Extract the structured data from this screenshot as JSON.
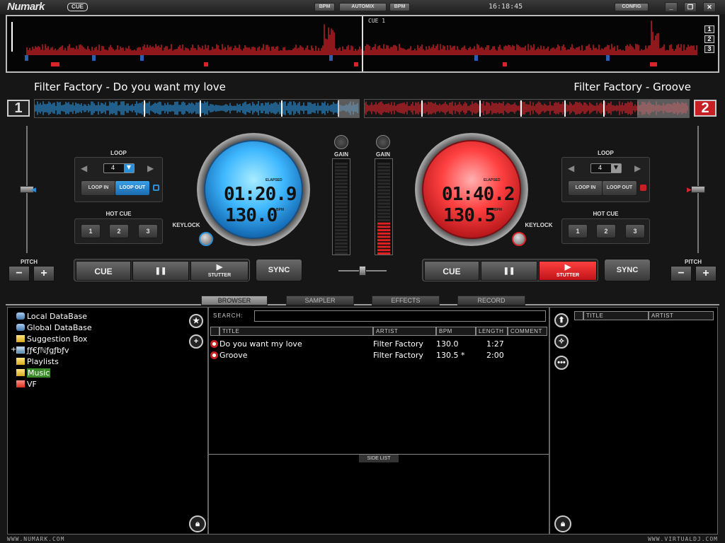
{
  "titlebar": {
    "logo": "Numark",
    "logo_tag": "CUE",
    "bpm_left": "BPM",
    "automix": "AUTOMIX",
    "bpm_right": "BPM",
    "clock": "16:18:45",
    "config": "CONFIG",
    "minimize": "_",
    "restore": "❐",
    "close": "✕"
  },
  "overview": {
    "cue_label": "CUE 1",
    "deck_selectors": [
      "1",
      "2",
      "3"
    ]
  },
  "deck1": {
    "number": "1",
    "title": "Filter Factory - Do you want my love",
    "loop_label": "LOOP",
    "loop_value": "4",
    "loop_in": "LOOP IN",
    "loop_out": "LOOP OUT",
    "hot_cue_label": "HOT CUE",
    "hot_cues": [
      "1",
      "2",
      "3"
    ],
    "pitch_label": "PITCH",
    "pitch_minus": "−",
    "pitch_plus": "+",
    "keylock": "KEYLOCK",
    "elapsed_label": "ELAPSED",
    "bpm_label": "BPM",
    "time": "01:20.9",
    "bpm": "130.0",
    "cue": "CUE",
    "pause": "❚❚",
    "play_icon": "▶",
    "stutter": "STUTTER",
    "sync": "SYNC",
    "gain": "GAIN",
    "accent": "#2a8fd6"
  },
  "deck2": {
    "number": "2",
    "title": "Filter Factory - Groove",
    "loop_label": "LOOP",
    "loop_value": "4",
    "loop_in": "LOOP IN",
    "loop_out": "LOOP OUT",
    "hot_cue_label": "HOT CUE",
    "hot_cues": [
      "1",
      "2",
      "3"
    ],
    "pitch_label": "PITCH",
    "pitch_minus": "−",
    "pitch_plus": "+",
    "keylock": "KEYLOCK",
    "elapsed_label": "ELAPSED",
    "bpm_label": "BPM",
    "time": "01:40.2",
    "bpm": "130.5",
    "cue": "CUE",
    "pause": "❚❚",
    "play_icon": "▶",
    "stutter": "STUTTER",
    "sync": "SYNC",
    "gain": "GAIN",
    "accent": "#d8242a"
  },
  "tabs": [
    "BROWSER",
    "SAMPLER",
    "EFFECTS",
    "RECORD"
  ],
  "browser": {
    "tree": [
      {
        "label": "Local DataBase",
        "icon": "database-icon"
      },
      {
        "label": "Global DataBase",
        "icon": "database-icon"
      },
      {
        "label": "Suggestion Box",
        "icon": "folder-icon"
      },
      {
        "label": "ƒƒ€ƒℕƒgƒbƒv",
        "icon": "drive-icon"
      },
      {
        "label": "Playlists",
        "icon": "folder-icon"
      },
      {
        "label": "Music",
        "icon": "folder-icon"
      },
      {
        "label": "VF",
        "icon": "folder-icon"
      }
    ],
    "expand_marker": "+",
    "search_label": "SEARCH:",
    "search_value": "",
    "columns": [
      "TITLE",
      "ARTIST",
      "BPM",
      "LENGTH",
      "COMMENT"
    ],
    "rows": [
      {
        "title": "Do you want my love",
        "artist": "Filter Factory",
        "bpm": "130.0",
        "length": "1:27"
      },
      {
        "title": "Groove",
        "artist": "Filter Factory",
        "bpm": "130.5 *",
        "length": "2:00"
      }
    ],
    "side_list": "SIDE LIST",
    "right_columns": [
      "TITLE",
      "ARTIST"
    ]
  },
  "footer": {
    "left": "WWW.NUMARK.COM",
    "right": "WWW.VIRTUALDJ.COM"
  }
}
